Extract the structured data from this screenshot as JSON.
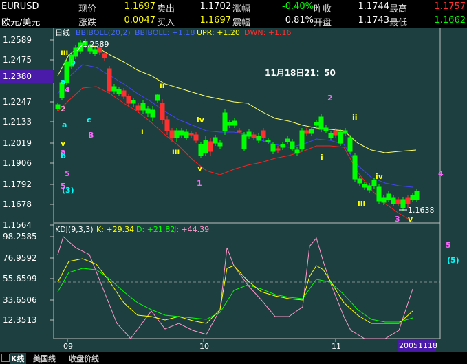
{
  "quote": {
    "symbol": "EURUSD",
    "name": "欧元/美元",
    "row1": [
      {
        "label": "现价",
        "value": "1.1697",
        "label2": "卖出"
      },
      {
        "value": "1.1702",
        "label2": "涨幅"
      },
      {
        "value": "-0.40%",
        "label2": "昨收"
      },
      {
        "value": "1.1744",
        "label2": "最高"
      },
      {
        "value": "1.1757"
      }
    ],
    "row2": [
      {
        "label": "涨跌",
        "value": "0.0047",
        "label2": "买入"
      },
      {
        "value": "1.1697",
        "label2": "震幅"
      },
      {
        "value": "0.81%",
        "label2": "开盘"
      },
      {
        "value": "1.1743",
        "label2": "最低"
      },
      {
        "value": "1.1662"
      }
    ]
  },
  "main_chart": {
    "period": "日线",
    "indicator": "BBIBOLL(20,2)",
    "bbiboll": "BBIBOLL: +1.18",
    "upr": "UPR: +1.20",
    "dwn": "DWN: +1.16",
    "price_ticks": [
      "1.2589",
      "1.2475",
      "1.2380",
      "1.2247",
      "1.2133",
      "1.2019",
      "1.1906",
      "1.1792",
      "1.1678",
      "1.1564"
    ],
    "highlight_price": "1.2380",
    "high_label": "1.2589",
    "low_label": "1.1638",
    "timestamp": "11月18日21：50",
    "colors": {
      "up": "#00ff00",
      "down": "#ff3030",
      "upper": "#ffff66",
      "mid": "#4444ff",
      "lower": "#ff2020"
    }
  },
  "wave_labels": [
    {
      "t": "iii",
      "c": "#ffff00"
    },
    {
      "t": "b",
      "c": "#00ffff"
    },
    {
      "t": "a",
      "c": "#00ffff"
    },
    {
      "t": "4",
      "c": "#ff66ff"
    },
    {
      "t": "2",
      "c": "#ff99cc"
    },
    {
      "t": "a",
      "c": "#00ffff"
    },
    {
      "t": "c",
      "c": "#00ffff"
    },
    {
      "t": "B",
      "c": "#ff66ff"
    },
    {
      "t": "v",
      "c": "#ffff00"
    },
    {
      "t": "a",
      "c": "#ff66ff"
    },
    {
      "t": "b",
      "c": "#00ffff"
    },
    {
      "t": "5",
      "c": "#ff66ff"
    },
    {
      "t": "5",
      "c": "#ff66ff"
    },
    {
      "t": "(3)",
      "c": "#00ffff"
    },
    {
      "t": "ii",
      "c": "#ffff00"
    },
    {
      "t": "i",
      "c": "#ffff00"
    },
    {
      "t": "iii",
      "c": "#ffff00"
    },
    {
      "t": "iv",
      "c": "#ffff00"
    },
    {
      "t": "v",
      "c": "#ffff00"
    },
    {
      "t": "1",
      "c": "#ff66ff"
    },
    {
      "t": "2",
      "c": "#ff66ff"
    },
    {
      "t": "ii",
      "c": "#ffff00"
    },
    {
      "t": "i",
      "c": "#ffff00"
    },
    {
      "t": "iv",
      "c": "#ffff00"
    },
    {
      "t": "iii",
      "c": "#ffff00"
    },
    {
      "t": "3",
      "c": "#ff66ff"
    },
    {
      "t": "v",
      "c": "#ffff00"
    },
    {
      "t": "4",
      "c": "#ff66ff"
    },
    {
      "t": "5",
      "c": "#ff66ff"
    },
    {
      "t": "(5)",
      "c": "#00ffff"
    }
  ],
  "kdj": {
    "title": "KDJ(9,3,3)",
    "k": "K: +29.34",
    "d": "D: +21.82",
    "j": "J: +44.39",
    "ticks": [
      "98.2585",
      "76.9592",
      "55.6599",
      "33.6506",
      "12.3513"
    ],
    "colors": {
      "k": "#ffff00",
      "d": "#00ff00",
      "j": "#ff99cc"
    }
  },
  "x_axis": {
    "labels": [
      "09",
      "10",
      "11"
    ],
    "date_box": "20051118"
  },
  "tabs": [
    {
      "label": "K线",
      "active": true
    },
    {
      "label": "美国线",
      "active": false
    },
    {
      "label": "收盘价线",
      "active": false
    }
  ]
}
